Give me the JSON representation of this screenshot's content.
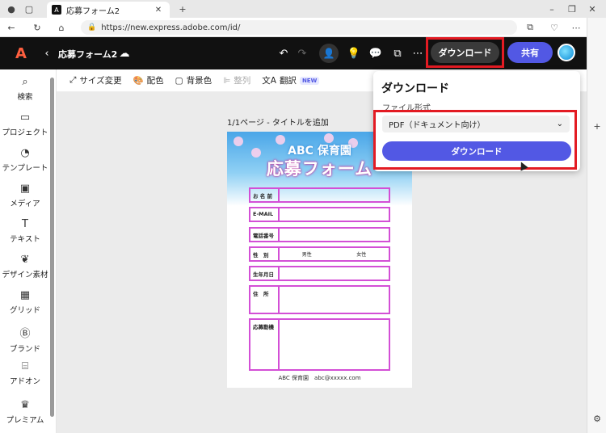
{
  "browser": {
    "tab_title": "応募フォーム2",
    "url": "https://new.express.adobe.com/id/"
  },
  "app": {
    "logo": "A",
    "doc_title": "応募フォーム2",
    "download_label": "ダウンロード",
    "share_label": "共有"
  },
  "sidebar": {
    "items": [
      {
        "label": "検索",
        "icon": "search-icon"
      },
      {
        "label": "プロジェクト",
        "icon": "folder-icon"
      },
      {
        "label": "テンプレート",
        "icon": "template-icon"
      },
      {
        "label": "メディア",
        "icon": "media-icon"
      },
      {
        "label": "テキスト",
        "icon": "text-icon"
      },
      {
        "label": "デザイン素材",
        "icon": "design-assets-icon"
      },
      {
        "label": "グリッド",
        "icon": "grid-icon"
      },
      {
        "label": "ブランド",
        "icon": "brand-icon"
      },
      {
        "label": "アドオン",
        "icon": "addon-icon"
      },
      {
        "label": "プレミアム",
        "icon": "premium-icon"
      }
    ]
  },
  "toolbar": {
    "resize": "サイズ変更",
    "color": "配色",
    "background": "背景色",
    "align": "整列",
    "translate": "翻訳",
    "new_badge": "NEW"
  },
  "canvas": {
    "page_label": "1/1ページ - タイトルを追加",
    "org_name": "ABC 保育園",
    "form_title": "応募フォーム",
    "fields": [
      {
        "label": "お 名 前",
        "value": ""
      },
      {
        "label": "E-MAIL",
        "value": ""
      },
      {
        "label": "電話番号",
        "value": ""
      },
      {
        "label": "性　別",
        "value": ""
      },
      {
        "label": "生年月日",
        "value": ""
      },
      {
        "label": "住　所",
        "value": ""
      },
      {
        "label": "応募動機",
        "value": ""
      }
    ],
    "gender_male": "男性",
    "gender_female": "女性",
    "footer": "ABC 保育園　abc@xxxxx.com"
  },
  "download_panel": {
    "title": "ダウンロード",
    "file_format_label": "ファイル形式",
    "selected_format": "PDF（ドキュメント向け）",
    "download_button": "ダウンロード"
  },
  "colors": {
    "accent": "#5258e4",
    "highlight": "#e31b23",
    "form_border": "#d34fd6"
  }
}
